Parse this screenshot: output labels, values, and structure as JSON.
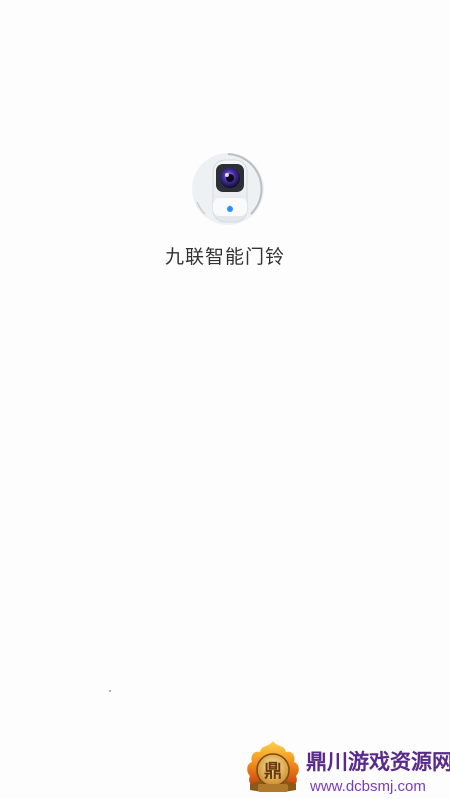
{
  "splash": {
    "app_name": "九联智能门铃",
    "icon": "doorbell-camera-icon"
  },
  "watermark": {
    "logo_char": "鼎",
    "title": "鼎川游戏资源网",
    "url": "www.dcbsmj.com"
  },
  "colors": {
    "background": "#fdfdfd",
    "app_name_text": "#333333",
    "watermark_title": "#5a2a8a",
    "watermark_url": "#7a3cc0"
  }
}
